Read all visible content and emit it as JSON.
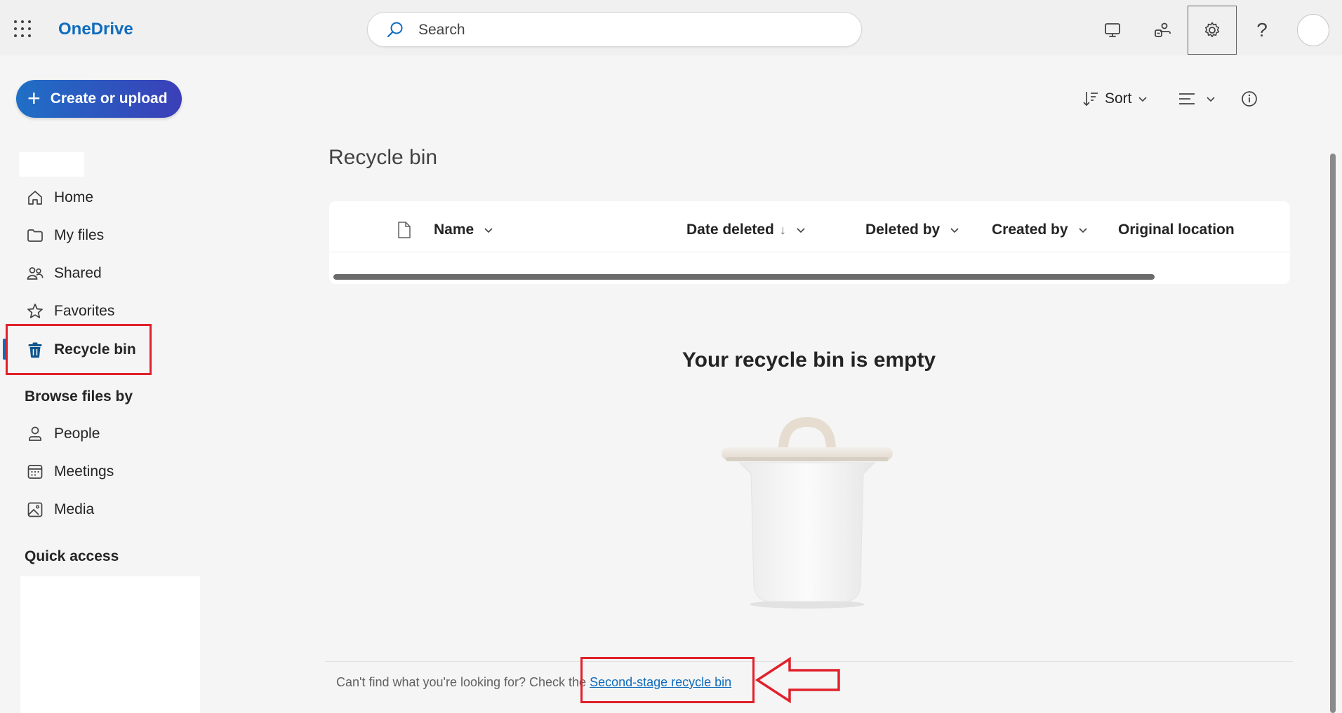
{
  "app": {
    "name": "OneDrive",
    "accent": "#0f6cbd"
  },
  "search": {
    "placeholder": "Search"
  },
  "top_icons": [
    "monitor-icon",
    "share-people-icon",
    "gear-icon",
    "help-icon"
  ],
  "top_icon_glyphs": {
    "help": "?"
  },
  "create_button": {
    "label": "Create or upload"
  },
  "nav": {
    "items": [
      {
        "label": "Home",
        "icon": "home-icon"
      },
      {
        "label": "My files",
        "icon": "folder-icon"
      },
      {
        "label": "Shared",
        "icon": "people-icon"
      },
      {
        "label": "Favorites",
        "icon": "star-icon"
      },
      {
        "label": "Recycle bin",
        "icon": "trash-icon",
        "active": true
      }
    ],
    "browse_heading": "Browse files by",
    "browse_items": [
      {
        "label": "People",
        "icon": "person-icon"
      },
      {
        "label": "Meetings",
        "icon": "calendar-icon"
      },
      {
        "label": "Media",
        "icon": "image-icon"
      }
    ],
    "quick_access_heading": "Quick access"
  },
  "command_bar": {
    "sort_label": "Sort"
  },
  "main": {
    "title": "Recycle bin",
    "columns": {
      "name": "Name",
      "date_deleted": "Date deleted",
      "date_deleted_arrow": "↓",
      "deleted_by": "Deleted by",
      "created_by": "Created by",
      "original_location": "Original location"
    },
    "empty_title": "Your recycle bin is empty"
  },
  "footer": {
    "text": "Can't find what you're looking for? Check the ",
    "link": "Second-stage recycle bin"
  },
  "annotation_color": "#e0212b"
}
